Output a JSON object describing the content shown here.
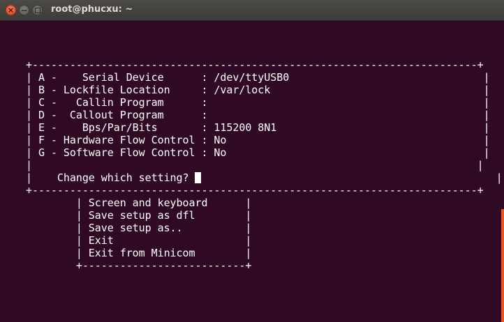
{
  "window": {
    "title": "root@phucxu: ~",
    "close_glyph": "×",
    "minimize_glyph": "−"
  },
  "terminal": {
    "menu_border_top": "+-----------------------------------------------------------------------+",
    "menu_rows": [
      "| A -    Serial Device      : /dev/ttyUSB0                               |",
      "| B - Lockfile Location     : /var/lock                                  |",
      "| C -   Callin Program      :                                            |",
      "| D -  Callout Program      :                                            |",
      "| E -    Bps/Par/Bits       : 115200 8N1                                 |",
      "| F - Hardware Flow Control : No                                         |",
      "| G - Software Flow Control : No                                         |",
      "|                                                                       |"
    ],
    "prompt_prefix": "|    ",
    "prompt_text": "Change which setting? ",
    "prompt_suffix": "                                               |",
    "menu_border_bottom": "+-----------------------------------------------------------------------+",
    "submenu_rows": [
      "        | Screen and keyboard      |",
      "        | Save setup as dfl        |",
      "        | Save setup as..          |",
      "        | Exit                     |",
      "        | Exit from Minicom        |"
    ],
    "submenu_border_bottom": "        +--------------------------+"
  },
  "colors": {
    "terminal_bg": "#300a24",
    "terminal_fg": "#ffffff",
    "scrollbar": "#e95420",
    "close_button": "#df4a16"
  }
}
